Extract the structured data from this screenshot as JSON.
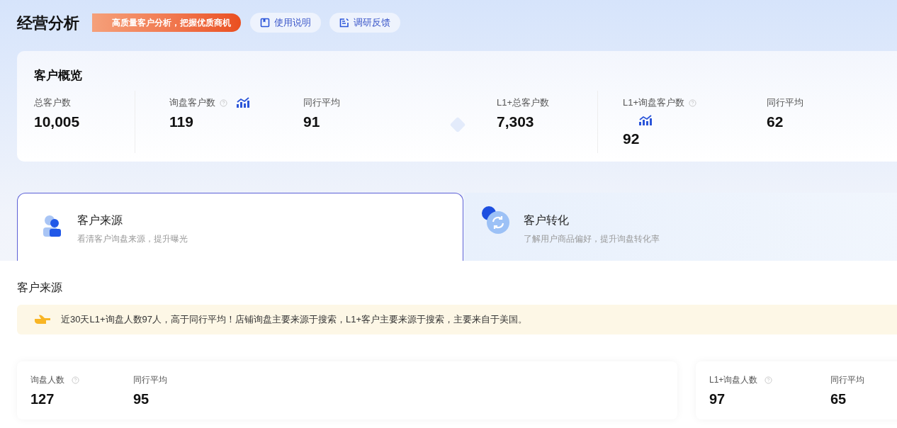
{
  "header": {
    "title": "经营分析",
    "promo": "高质量客户分析，把握优质商机",
    "buttons": [
      {
        "kind": "guide",
        "label": "使用说明"
      },
      {
        "kind": "feedback",
        "label": "调研反馈"
      }
    ]
  },
  "overview": {
    "title": "客户概览",
    "groups": [
      {
        "metrics": [
          {
            "kind": "plain",
            "label": "总客户数",
            "value": "10,005"
          }
        ]
      },
      {
        "metrics": [
          {
            "kind": "trend",
            "label": "询盘客户数",
            "value": "119"
          },
          {
            "kind": "plain",
            "label": "同行平均",
            "value": "91"
          }
        ]
      },
      {
        "metrics": [
          {
            "kind": "plain",
            "label": "L1+总客户数",
            "value": "7,303"
          }
        ]
      },
      {
        "metrics": [
          {
            "kind": "stacked",
            "label": "L1+询盘客户数",
            "value": "92"
          },
          {
            "kind": "plain",
            "label": "同行平均",
            "value": "62"
          }
        ]
      }
    ]
  },
  "tabs": [
    {
      "kind": "source",
      "title": "客户来源",
      "subtitle": "看清客户询盘来源，提升曝光",
      "selected": true
    },
    {
      "kind": "conversion",
      "title": "客户转化",
      "subtitle": "了解用户商品偏好，提升询盘转化率",
      "selected": false
    }
  ],
  "section": {
    "title": "客户来源",
    "tip": "近30天L1+询盘人数97人，高于同行平均！店铺询盘主要来源于搜索，L1+客户主要来源于搜索，主要来自于美国。",
    "cards": [
      {
        "metrics": [
          {
            "kind": "help",
            "label": "询盘人数",
            "value": "127"
          },
          {
            "kind": "plain",
            "label": "同行平均",
            "value": "95"
          }
        ]
      },
      {
        "metrics": [
          {
            "kind": "help",
            "label": "L1+询盘人数",
            "value": "97"
          },
          {
            "kind": "plain",
            "label": "同行平均",
            "value": "65"
          }
        ]
      }
    ]
  }
}
